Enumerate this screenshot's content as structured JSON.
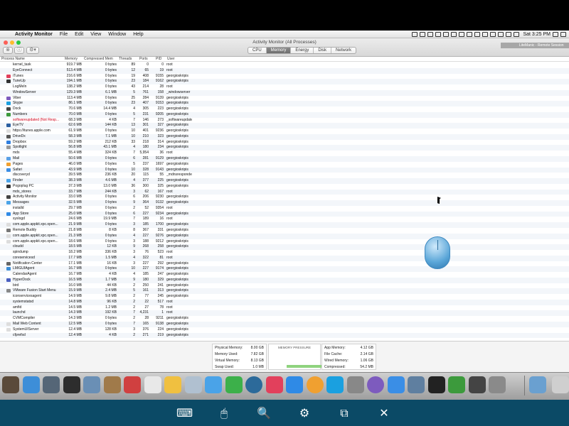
{
  "menubar": {
    "app": "Activity Monitor",
    "menus": [
      "File",
      "Edit",
      "View",
      "Window",
      "Help"
    ],
    "clock": "Sat 3:25 PM"
  },
  "window": {
    "title": "Activity Monitor (All Processes)",
    "tabs": [
      "CPU",
      "Memory",
      "Energy",
      "Disk",
      "Network"
    ],
    "active_tab": "Memory",
    "remote_label": "LiteManic - Remote Session"
  },
  "table": {
    "headers": [
      "Process Name",
      "Memory",
      "Compressed Mem",
      "Threads",
      "Ports",
      "PID",
      "User"
    ],
    "rows": [
      {
        "name": "kernel_task",
        "mem": "919.7 MB",
        "cmem": "0 bytes",
        "thr": "89",
        "ports": "0",
        "pid": "0",
        "user": "root",
        "icon": "",
        "color": ""
      },
      {
        "name": "EyeConnect",
        "mem": "513.4 MB",
        "cmem": "0 bytes",
        "thr": "12",
        "ports": "65",
        "pid": "19",
        "user": "root",
        "icon": "",
        "color": ""
      },
      {
        "name": "iTunes",
        "mem": "216.6 MB",
        "cmem": "0 bytes",
        "thr": "19",
        "ports": "408",
        "pid": "9155",
        "user": "georgioskripis",
        "icon": "#e2405c",
        "color": ""
      },
      {
        "name": "TuneUp",
        "mem": "194.1 MB",
        "cmem": "0 bytes",
        "thr": "23",
        "ports": "184",
        "pid": "9162",
        "user": "georgioskripis",
        "icon": "#333333",
        "color": ""
      },
      {
        "name": "LogMeIn",
        "mem": "138.2 MB",
        "cmem": "0 bytes",
        "thr": "43",
        "ports": "214",
        "pid": "28",
        "user": "root",
        "icon": "",
        "color": ""
      },
      {
        "name": "WindowServer",
        "mem": "129.3 MB",
        "cmem": "6.1 MB",
        "thr": "5",
        "ports": "761",
        "pid": "158",
        "user": "_windowserver",
        "icon": "",
        "color": ""
      },
      {
        "name": "Viber",
        "mem": "113.4 MB",
        "cmem": "0 bytes",
        "thr": "25",
        "ports": "284",
        "pid": "9139",
        "user": "georgioskripis",
        "icon": "#7d5bbe",
        "color": ""
      },
      {
        "name": "Skype",
        "mem": "86.1 MB",
        "cmem": "0 bytes",
        "thr": "23",
        "ports": "407",
        "pid": "9153",
        "user": "georgioskripis",
        "icon": "#1aa0e0",
        "color": ""
      },
      {
        "name": "Dock",
        "mem": "70.6 MB",
        "cmem": "14.4 MB",
        "thr": "4",
        "ports": "305",
        "pid": "223",
        "user": "georgioskripis",
        "icon": "#444444",
        "color": ""
      },
      {
        "name": "Numbers",
        "mem": "70.0 MB",
        "cmem": "0 bytes",
        "thr": "5",
        "ports": "231",
        "pid": "9205",
        "user": "georgioskripis",
        "icon": "#3c9a3c",
        "color": ""
      },
      {
        "name": "softwareupdated (Not Resp...",
        "mem": "68.3 MB",
        "cmem": "4 KB",
        "thr": "7",
        "ports": "146",
        "pid": "273",
        "user": "_softwareupdate",
        "icon": "",
        "color": "red"
      },
      {
        "name": "EyeTV",
        "mem": "62.6 MB",
        "cmem": "144 KB",
        "thr": "13",
        "ports": "301",
        "pid": "327",
        "user": "georgioskripis",
        "icon": "#2b5fa0",
        "color": ""
      },
      {
        "name": "https://itunes.apple.com",
        "mem": "61.9 MB",
        "cmem": "0 bytes",
        "thr": "10",
        "ports": "401",
        "pid": "9236",
        "user": "georgioskripis",
        "icon": "#dddddd",
        "color": ""
      },
      {
        "name": "DriveDx",
        "mem": "58.3 MB",
        "cmem": "7.1 MB",
        "thr": "10",
        "ports": "210",
        "pid": "323",
        "user": "georgioskripis",
        "icon": "#555555",
        "color": ""
      },
      {
        "name": "Dropbox",
        "mem": "59.2 MB",
        "cmem": "212 KB",
        "thr": "33",
        "ports": "218",
        "pid": "314",
        "user": "georgioskripis",
        "icon": "#2f7fe0",
        "color": ""
      },
      {
        "name": "Spotlight",
        "mem": "56.8 MB",
        "cmem": "43.1 MB",
        "thr": "4",
        "ports": "180",
        "pid": "234",
        "user": "georgioskripis",
        "icon": "#999999",
        "color": ""
      },
      {
        "name": "mds",
        "mem": "55.4 MB",
        "cmem": "324 KB",
        "thr": "7",
        "ports": "5,954",
        "pid": "36",
        "user": "root",
        "icon": "",
        "color": ""
      },
      {
        "name": "Mail",
        "mem": "50.6 MB",
        "cmem": "0 bytes",
        "thr": "6",
        "ports": "281",
        "pid": "9129",
        "user": "georgioskripis",
        "icon": "#5aa0e6",
        "color": ""
      },
      {
        "name": "Pages",
        "mem": "46.0 MB",
        "cmem": "0 bytes",
        "thr": "5",
        "ports": "237",
        "pid": "1697",
        "user": "georgioskripis",
        "icon": "#f0a030",
        "color": ""
      },
      {
        "name": "Safari",
        "mem": "43.9 MB",
        "cmem": "0 bytes",
        "thr": "10",
        "ports": "328",
        "pid": "9143",
        "user": "georgioskripis",
        "icon": "#3a8ee6",
        "color": ""
      },
      {
        "name": "discoveryd",
        "mem": "39.5 MB",
        "cmem": "236 KB",
        "thr": "20",
        "ports": "115",
        "pid": "55",
        "user": "_mdnsresponder",
        "icon": "",
        "color": ""
      },
      {
        "name": "Finder",
        "mem": "38.3 MB",
        "cmem": "4.6 MB",
        "thr": "4",
        "ports": "377",
        "pid": "225",
        "user": "georgioskripis",
        "icon": "#4aa3e8",
        "color": ""
      },
      {
        "name": "Pogoplug PC",
        "mem": "37.3 MB",
        "cmem": "13.0 MB",
        "thr": "36",
        "ports": "300",
        "pid": "325",
        "user": "georgioskripis",
        "icon": "#333333",
        "color": ""
      },
      {
        "name": "mds_stores",
        "mem": "33.7 MB",
        "cmem": "244 KB",
        "thr": "3",
        "ports": "62",
        "pid": "167",
        "user": "root",
        "icon": "",
        "color": ""
      },
      {
        "name": "Activity Monitor",
        "mem": "33.0 MB",
        "cmem": "0 bytes",
        "thr": "6",
        "ports": "206",
        "pid": "9230",
        "user": "georgioskripis",
        "icon": "#444444",
        "color": ""
      },
      {
        "name": "Messages",
        "mem": "32.5 MB",
        "cmem": "0 bytes",
        "thr": "9",
        "ports": "364",
        "pid": "9132",
        "user": "georgioskripis",
        "icon": "#4aa3e8",
        "color": ""
      },
      {
        "name": "installd",
        "mem": "29.7 MB",
        "cmem": "0 bytes",
        "thr": "2",
        "ports": "52",
        "pid": "9354",
        "user": "root",
        "icon": "",
        "color": ""
      },
      {
        "name": "App Store",
        "mem": "25.0 MB",
        "cmem": "0 bytes",
        "thr": "6",
        "ports": "227",
        "pid": "9234",
        "user": "georgioskripis",
        "icon": "#2f8ae6",
        "color": ""
      },
      {
        "name": "syslogd",
        "mem": "24.6 MB",
        "cmem": "19.9 MB",
        "thr": "7",
        "ports": "189",
        "pid": "16",
        "user": "root",
        "icon": "",
        "color": ""
      },
      {
        "name": "com.apple.appkit.xpc.open...",
        "mem": "21.9 MB",
        "cmem": "0 bytes",
        "thr": "3",
        "ports": "185",
        "pid": "1700",
        "user": "georgioskripis",
        "icon": "#dddddd",
        "color": ""
      },
      {
        "name": "Remote Buddy",
        "mem": "21.8 MB",
        "cmem": "8 KB",
        "thr": "8",
        "ports": "367",
        "pid": "331",
        "user": "georgioskripis",
        "icon": "#777777",
        "color": ""
      },
      {
        "name": "com.apple.appkit.xpc.open...",
        "mem": "21.3 MB",
        "cmem": "0 bytes",
        "thr": "4",
        "ports": "227",
        "pid": "9276",
        "user": "georgioskripis",
        "icon": "#dddddd",
        "color": ""
      },
      {
        "name": "com.apple.appkit.xpc.open...",
        "mem": "18.6 MB",
        "cmem": "0 bytes",
        "thr": "3",
        "ports": "188",
        "pid": "9212",
        "user": "georgioskripis",
        "icon": "#dddddd",
        "color": ""
      },
      {
        "name": "cloudd",
        "mem": "18.5 MB",
        "cmem": "12 KB",
        "thr": "9",
        "ports": "268",
        "pid": "258",
        "user": "georgioskripis",
        "icon": "",
        "color": ""
      },
      {
        "name": "spindump",
        "mem": "18.2 MB",
        "cmem": "336 KB",
        "thr": "3",
        "ports": "76",
        "pid": "523",
        "user": "root",
        "icon": "",
        "color": ""
      },
      {
        "name": "coreservicesd",
        "mem": "17.7 MB",
        "cmem": "1.5 MB",
        "thr": "4",
        "ports": "322",
        "pid": "81",
        "user": "root",
        "icon": "",
        "color": ""
      },
      {
        "name": "Notification Center",
        "mem": "17.1 MB",
        "cmem": "16 KB",
        "thr": "3",
        "ports": "227",
        "pid": "292",
        "user": "georgioskripis",
        "icon": "#666666",
        "color": ""
      },
      {
        "name": "LMIGUIAgent",
        "mem": "16.7 MB",
        "cmem": "0 bytes",
        "thr": "10",
        "ports": "227",
        "pid": "9174",
        "user": "georgioskripis",
        "icon": "#3d8ed8",
        "color": ""
      },
      {
        "name": "CalendarAgent",
        "mem": "16.7 MB",
        "cmem": "4 KB",
        "thr": "4",
        "ports": "185",
        "pid": "247",
        "user": "georgioskripis",
        "icon": "",
        "color": ""
      },
      {
        "name": "HyperDock",
        "mem": "16.5 MB",
        "cmem": "1.7 MB",
        "thr": "9",
        "ports": "180",
        "pid": "329",
        "user": "georgioskripis",
        "icon": "#4a5fc0",
        "color": ""
      },
      {
        "name": "bird",
        "mem": "16.0 MB",
        "cmem": "44 KB",
        "thr": "2",
        "ports": "250",
        "pid": "241",
        "user": "georgioskripis",
        "icon": "",
        "color": ""
      },
      {
        "name": "VMware Fusion Start Menu",
        "mem": "15.9 MB",
        "cmem": "2.4 MB",
        "thr": "5",
        "ports": "161",
        "pid": "313",
        "user": "georgioskripis",
        "icon": "#888888",
        "color": ""
      },
      {
        "name": "iconservicesagent",
        "mem": "14.9 MB",
        "cmem": "9.8 MB",
        "thr": "2",
        "ports": "77",
        "pid": "245",
        "user": "georgioskripis",
        "icon": "",
        "color": ""
      },
      {
        "name": "systemstatsd",
        "mem": "14.8 MB",
        "cmem": "96 KB",
        "thr": "2",
        "ports": "22",
        "pid": "517",
        "user": "root",
        "icon": "",
        "color": ""
      },
      {
        "name": "amfid",
        "mem": "14.5 MB",
        "cmem": "1.2 MB",
        "thr": "2",
        "ports": "27",
        "pid": "78",
        "user": "root",
        "icon": "",
        "color": ""
      },
      {
        "name": "launchd",
        "mem": "14.3 MB",
        "cmem": "192 KB",
        "thr": "7",
        "ports": "4,231",
        "pid": "1",
        "user": "root",
        "icon": "",
        "color": ""
      },
      {
        "name": "CVMCompiler",
        "mem": "14.3 MB",
        "cmem": "0 bytes",
        "thr": "2",
        "ports": "28",
        "pid": "9211",
        "user": "georgioskripis",
        "icon": "",
        "color": ""
      },
      {
        "name": "Mail Web Content",
        "mem": "12.5 MB",
        "cmem": "0 bytes",
        "thr": "7",
        "ports": "165",
        "pid": "9138",
        "user": "georgioskripis",
        "icon": "#dddddd",
        "color": ""
      },
      {
        "name": "SystemUIServer",
        "mem": "12.4 MB",
        "cmem": "128 KB",
        "thr": "3",
        "ports": "376",
        "pid": "224",
        "user": "georgioskripis",
        "icon": "#dddddd",
        "color": ""
      },
      {
        "name": "cfprefsd",
        "mem": "12.4 MB",
        "cmem": "4 KB",
        "thr": "2",
        "ports": "271",
        "pid": "219",
        "user": "georgioskripis",
        "icon": "",
        "color": ""
      }
    ]
  },
  "memory": {
    "left": [
      {
        "label": "Physical Memory:",
        "value": "8.00 GB"
      },
      {
        "label": "Memory Used:",
        "value": "7.82 GB"
      },
      {
        "label": "Virtual Memory:",
        "value": "8.13 GB"
      },
      {
        "label": "Swap Used:",
        "value": "1.0 MB"
      }
    ],
    "pressure_title": "MEMORY PRESSURE",
    "right": [
      {
        "label": "App Memory:",
        "value": "4.12 GB"
      },
      {
        "label": "File Cache:",
        "value": "2.14 GB"
      },
      {
        "label": "Wired Memory:",
        "value": "1.06 GB"
      },
      {
        "label": "Compressed:",
        "value": "54.2 MB"
      }
    ]
  },
  "dock": {
    "colors": [
      "#5a4a3a",
      "#3d8ed8",
      "#556677",
      "#2d2d2d",
      "#6a8fb5",
      "#a07a4a",
      "#d04040",
      "#e8e8e8",
      "#f0c040",
      "#b0c0d0",
      "#4aa3e8",
      "#3cb04a",
      "#2c6a9a",
      "#e2405c",
      "#2f8ae6",
      "#f0a030",
      "#1aa0e0",
      "#888888",
      "#7d5bbe",
      "#3a8ee6",
      "#5f7fa0",
      "#222222",
      "#3c9a3c",
      "#444444",
      "#8a8a8a",
      "#6aa0d0",
      "#cfcfcf"
    ]
  },
  "toolbar": {
    "icons": [
      "keyboard-icon",
      "mouse-icon",
      "zoom-icon",
      "settings-icon",
      "screens-icon",
      "close-icon"
    ]
  }
}
